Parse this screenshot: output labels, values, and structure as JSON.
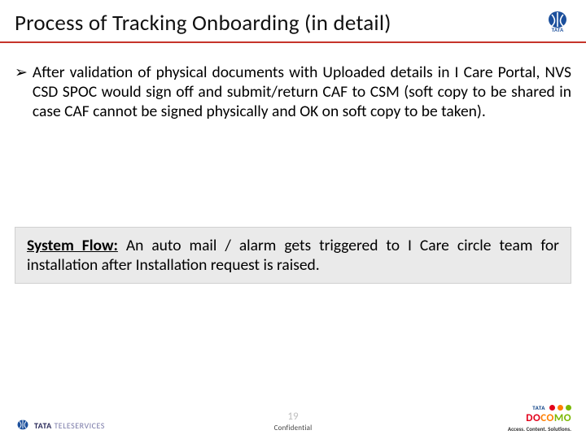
{
  "title": "Process of Tracking Onboarding (in detail)",
  "bullet_prefix": "➢",
  "bullet_text": "After validation of physical documents with Uploaded details in I Care Portal, NVS CSD SPOC would sign off and submit/return CAF to CSM (soft copy to be shared in case CAF cannot be signed physically and OK on soft copy to be taken).",
  "flow_label": "System Flow:",
  "flow_text": " An auto mail / alarm gets triggered to I Care circle team for installation after Installation request is raised.",
  "page_number": "19",
  "confidential": "Confidential",
  "footer_left_brand_a": "TATA",
  "footer_left_brand_b": "TELESERVICES",
  "docomo_tata": "TATA",
  "docomo": {
    "a": "DO",
    "b": "CO",
    "c": "MO"
  },
  "docomo_tag_a": "Access.",
  "docomo_tag_b": "Content.",
  "docomo_tag_c": "Solutions.",
  "colors": {
    "rule": "#c6342a",
    "dot1": "#e2001a",
    "dot2": "#ff7f00",
    "dot3": "#7ab800",
    "tata": "#1b4f9c"
  }
}
